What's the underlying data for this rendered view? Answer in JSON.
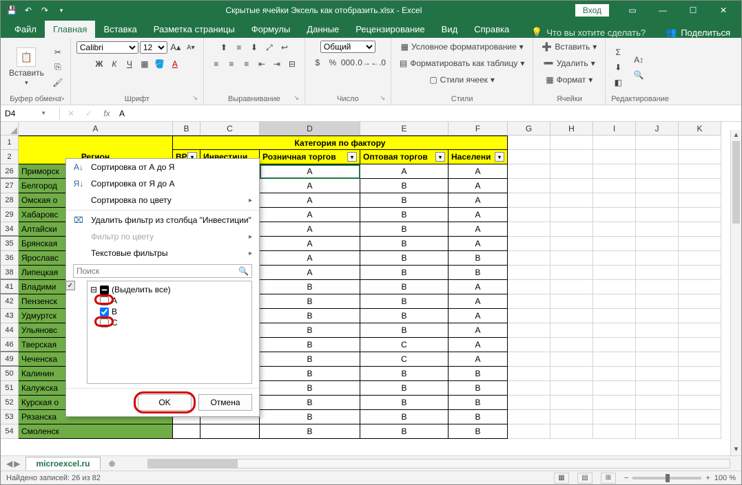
{
  "title": "Скрытые ячейки Эксель как отобразить.xlsx  -  Excel",
  "login": "Вход",
  "tabs": {
    "file": "Файл",
    "home": "Главная",
    "insert": "Вставка",
    "layout": "Разметка страницы",
    "formulas": "Формулы",
    "data": "Данные",
    "review": "Рецензирование",
    "view": "Вид",
    "help": "Справка",
    "tellme": "Что вы хотите сделать?",
    "share": "Поделиться"
  },
  "ribbon": {
    "clipboard": {
      "paste": "Вставить",
      "label": "Буфер обмена"
    },
    "font": {
      "name": "Calibri",
      "size": "12",
      "label": "Шрифт"
    },
    "align": {
      "label": "Выравнивание"
    },
    "number": {
      "label": "Число",
      "format": "Общий"
    },
    "styles": {
      "cond": "Условное форматирование",
      "table": "Форматировать как таблицу",
      "cell": "Стили ячеек",
      "label": "Стили"
    },
    "cells": {
      "insert": "Вставить",
      "delete": "Удалить",
      "format": "Формат",
      "label": "Ячейки"
    },
    "edit": {
      "label": "Редактирование"
    }
  },
  "namebox": "D4",
  "formula": "A",
  "columns": [
    "A",
    "B",
    "C",
    "D",
    "E",
    "F",
    "G",
    "H",
    "I",
    "J",
    "K"
  ],
  "header": {
    "merged": "Категория по фактору",
    "region": "Регион",
    "b": "ВР",
    "c": "Инвестици",
    "d": "Розничная торгов",
    "e": "Оптовая торгов",
    "f": "Населени"
  },
  "rows": [
    {
      "n": 26,
      "a": "Приморск",
      "d": "A",
      "e": "A",
      "f": "A"
    },
    {
      "n": 27,
      "a": "Белгород",
      "d": "A",
      "e": "B",
      "f": "A"
    },
    {
      "n": 28,
      "a": "Омская о",
      "d": "A",
      "e": "B",
      "f": "A"
    },
    {
      "n": 29,
      "a": "Хабаровс",
      "d": "A",
      "e": "B",
      "f": "A"
    },
    {
      "n": 34,
      "a": "Алтайски",
      "d": "A",
      "e": "B",
      "f": "A"
    },
    {
      "n": 35,
      "a": "Брянская",
      "d": "A",
      "e": "B",
      "f": "A"
    },
    {
      "n": 36,
      "a": "Ярославс",
      "d": "A",
      "e": "B",
      "f": "B"
    },
    {
      "n": 38,
      "a": "Липецкая",
      "d": "A",
      "e": "B",
      "f": "B"
    },
    {
      "n": 41,
      "a": "Владими",
      "d": "B",
      "e": "B",
      "f": "A"
    },
    {
      "n": 42,
      "a": "Пензенск",
      "d": "B",
      "e": "B",
      "f": "A"
    },
    {
      "n": 43,
      "a": "Удмуртск",
      "d": "B",
      "e": "B",
      "f": "A"
    },
    {
      "n": 44,
      "a": "Ульяновс",
      "d": "B",
      "e": "B",
      "f": "A"
    },
    {
      "n": 46,
      "a": "Тверская",
      "d": "B",
      "e": "C",
      "f": "A"
    },
    {
      "n": 49,
      "a": "Чеченска",
      "d": "B",
      "e": "C",
      "f": "A"
    },
    {
      "n": 50,
      "a": "Калинин",
      "d": "B",
      "e": "B",
      "f": "B"
    },
    {
      "n": 51,
      "a": "Калужска",
      "d": "B",
      "e": "B",
      "f": "B"
    },
    {
      "n": 52,
      "a": "Курская о",
      "d": "B",
      "e": "B",
      "f": "B"
    },
    {
      "n": 53,
      "a": "Рязанска",
      "d": "B",
      "e": "B",
      "f": "B"
    },
    {
      "n": 54,
      "a": "Смоленск",
      "d": "B",
      "e": "B",
      "f": "B"
    }
  ],
  "filter": {
    "sortAZ": "Сортировка от А до Я",
    "sortZA": "Сортировка от Я до А",
    "sortColor": "Сортировка по цвету",
    "clear": "Удалить фильтр из столбца \"Инвестиции\"",
    "filterColor": "Фильтр по цвету",
    "textFilters": "Текстовые фильтры",
    "search": "Поиск",
    "selectAll": "(Выделить все)",
    "optA": "A",
    "optB": "B",
    "optC": "C",
    "ok": "OK",
    "cancel": "Отмена"
  },
  "sheet": "microexcel.ru",
  "status": "Найдено записей: 26 из 82",
  "zoom": "100 %"
}
